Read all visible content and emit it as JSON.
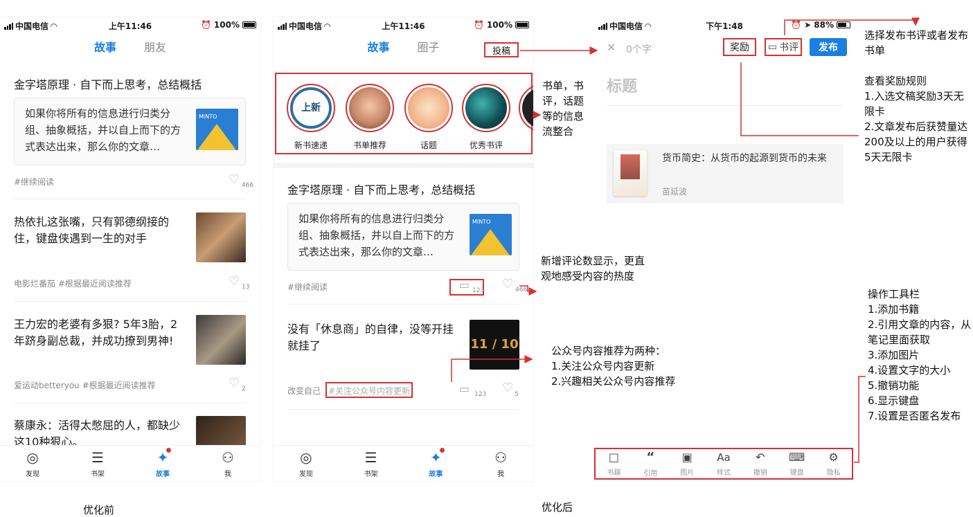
{
  "status": {
    "carrier": "中国电信",
    "time_am": "上午11:46",
    "time_pm": "下午1:48",
    "battery_full": "100%",
    "battery_88": "88%"
  },
  "tabs": {
    "story": "故事",
    "friends": "朋友",
    "circle": "圈子"
  },
  "post_button": "投稿",
  "feed": {
    "post1_title": "金字塔原理 · 自下而上思考，总结概括",
    "post1_quote": "如果你将所有的信息进行归类分组、抽象概括，并以自上而下的方式表达出来，那么你的文章…",
    "post1_tag": "#继续阅读",
    "post1_likes": "466",
    "post1_comments": "123",
    "post2_title": "热依扎这张嘴，只有郭德纲接的住，键盘侠遇到一生的对手",
    "post2_meta": "电影烂番茄  #根据最近阅读推荐",
    "post2_likes": "13",
    "post3_title": "王力宏的老婆有多狠? 5年3胎，2年跻身副总裁，并成功撩到男神!",
    "post3_meta": "爱运动betteryou  #根据最近阅读推荐",
    "post3_likes": "2",
    "post4_title": "蔡康永：活得太憋屈的人，都缺少这10种狠心。",
    "post5_title": "没有「休息商」的自律，没等开挂就挂了",
    "post5_source": "改变自己",
    "post5_tag": "#关注公众号内容更新",
    "post5_comments": "123",
    "post5_likes": "5",
    "book_cover_text": "THE MINTO PYRAMID PRINCIPLE",
    "clock_text": "11 / 10",
    "clock_small": "2 0 1 9"
  },
  "stories": [
    {
      "label": "新书速递",
      "badge": "上新"
    },
    {
      "label": "书单推荐"
    },
    {
      "label": "话题"
    },
    {
      "label": "优秀书评"
    }
  ],
  "tabbar": [
    "发现",
    "书架",
    "故事",
    "我"
  ],
  "editor": {
    "close": "✕",
    "word_count": "0个字",
    "reward": "奖励",
    "review": "书评",
    "publish": "发布",
    "title_placeholder": "标题",
    "book_title": "货币简史：从货币的起源到货币的未来",
    "book_author": "苗延波",
    "tools": [
      "书籍",
      "引用",
      "图片",
      "样式",
      "撤销",
      "键盘",
      "隐私"
    ],
    "tool_glyphs": [
      "□",
      "“",
      "▣",
      "Aa",
      "↶",
      "⌨",
      "⚙"
    ]
  },
  "annotations": {
    "booklist": "书单，书评，话题等的信息流整合",
    "choose": "选择发布书评或者发布书单",
    "rules_title": "查看奖励规则",
    "rules_1": "1.入选文稿奖励3天无限卡",
    "rules_2": "2.文章发布后获赞量达200及以上的用户获得5天无限卡",
    "comments": "新增评论数显示，更直观地感受内容的热度",
    "wechat_title": "公众号内容推荐为两种：",
    "wechat_1": "1.关注公众号内容更新",
    "wechat_2": "2.兴趣相关公众号内容推荐",
    "toolbar_title": "操作工具栏",
    "toolbar_1": "1.添加书籍",
    "toolbar_2": "2.引用文章的内容，从笔记里面获取",
    "toolbar_3": "3.添加图片",
    "toolbar_4": "4.设置文字的大小",
    "toolbar_5": "5.撤销功能",
    "toolbar_6": "6.显示键盘",
    "toolbar_7": "7.设置是否匿名发布"
  },
  "captions": {
    "before": "优化前",
    "after": "优化后"
  },
  "colors": {
    "accent": "#1a7fe0",
    "annotation_red": "#d63031"
  }
}
